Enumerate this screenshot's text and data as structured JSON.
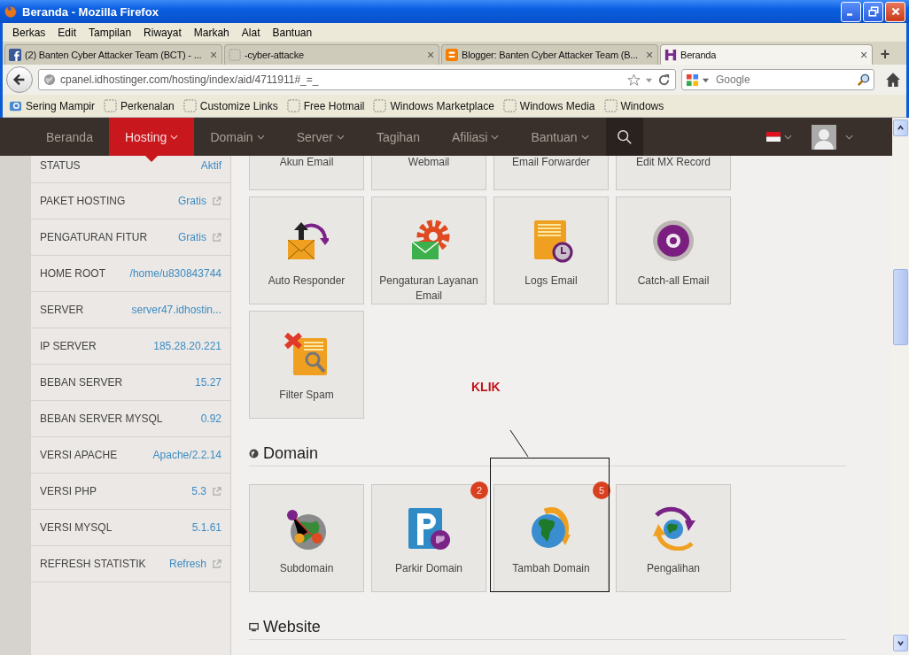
{
  "window": {
    "title": "Beranda - Mozilla Firefox"
  },
  "menu": [
    "Berkas",
    "Edit",
    "Tampilan",
    "Riwayat",
    "Markah",
    "Alat",
    "Bantuan"
  ],
  "tabs": [
    {
      "label": "(2) Banten Cyber Attacker Team (BCT) - ...",
      "selected": false,
      "close": "×"
    },
    {
      "label": "-cyber-attacke",
      "selected": false,
      "close": "×"
    },
    {
      "label": "Blogger: Banten Cyber Attacker Team (B...",
      "selected": false,
      "close": "×"
    },
    {
      "label": "Beranda",
      "selected": true,
      "close": "×"
    }
  ],
  "new_tab": "+",
  "address": {
    "value": "cpanel.idhostinger.com/hosting/index/aid/4711911#_=_"
  },
  "search": {
    "placeholder": "Google"
  },
  "bookmarks": [
    "Sering Mampir",
    "Perkenalan",
    "Customize Links",
    "Free Hotmail",
    "Windows Marketplace",
    "Windows Media",
    "Windows"
  ],
  "site_nav": [
    {
      "label": "Beranda",
      "dropdown": false,
      "selected": false
    },
    {
      "label": "Hosting",
      "dropdown": true,
      "selected": true
    },
    {
      "label": "Domain",
      "dropdown": true,
      "selected": false
    },
    {
      "label": "Server",
      "dropdown": true,
      "selected": false
    },
    {
      "label": "Tagihan",
      "dropdown": false,
      "selected": false
    },
    {
      "label": "Afiliasi",
      "dropdown": true,
      "selected": false
    },
    {
      "label": "Bantuan",
      "dropdown": true,
      "selected": false
    }
  ],
  "sidebar": [
    {
      "label": "STATUS",
      "value": "Aktif",
      "external": false
    },
    {
      "label": "PAKET HOSTING",
      "value": "Gratis",
      "external": true
    },
    {
      "label": "PENGATURAN FITUR",
      "value": "Gratis",
      "external": true
    },
    {
      "label": "HOME ROOT",
      "value": "/home/u830843744",
      "external": false
    },
    {
      "label": "SERVER",
      "value": "server47.idhostin...",
      "external": false
    },
    {
      "label": "IP SERVER",
      "value": "185.28.20.221",
      "external": false
    },
    {
      "label": "BEBAN SERVER",
      "value": "15.27",
      "external": false
    },
    {
      "label": "BEBAN SERVER MYSQL",
      "value": "0.92",
      "external": false
    },
    {
      "label": "VERSI APACHE",
      "value": "Apache/2.2.14",
      "external": false
    },
    {
      "label": "VERSI PHP",
      "value": "5.3",
      "external": true
    },
    {
      "label": "VERSI MYSQL",
      "value": "5.1.61",
      "external": false
    },
    {
      "label": "REFRESH STATISTIK",
      "value": "Refresh",
      "external": true
    }
  ],
  "sections": [
    {
      "tiles": [
        {
          "label": "Akun Email"
        },
        {
          "label": "Webmail"
        },
        {
          "label": "Email Forwarder"
        },
        {
          "label": "Edit MX Record"
        },
        {
          "label": "Auto Responder"
        },
        {
          "label": "Pengaturan Layanan Email"
        },
        {
          "label": "Logs Email"
        },
        {
          "label": "Catch-all Email"
        },
        {
          "label": "Filter Spam"
        }
      ]
    },
    {
      "title": "Domain",
      "tiles": [
        {
          "label": "Subdomain"
        },
        {
          "label": "Parkir Domain",
          "badge": "2"
        },
        {
          "label": "Tambah Domain",
          "badge": "5"
        },
        {
          "label": "Pengalihan"
        }
      ]
    },
    {
      "title": "Website"
    }
  ],
  "annotation": {
    "text": "KLIK"
  }
}
